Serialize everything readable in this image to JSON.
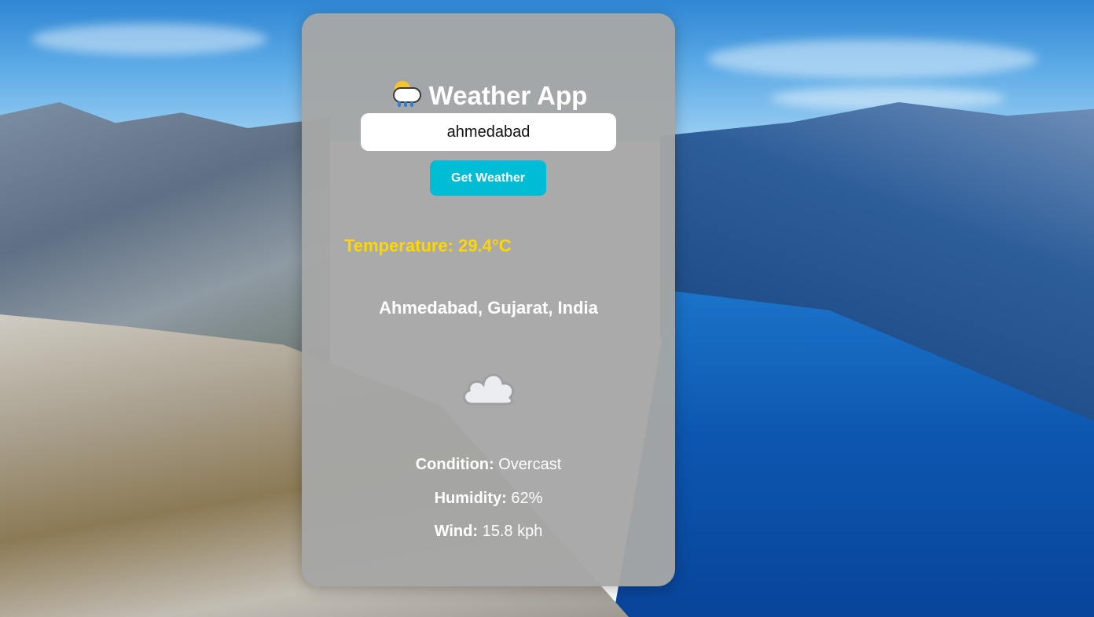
{
  "app": {
    "title": "Weather App",
    "title_icon": "sun-behind-rain-cloud-icon"
  },
  "search": {
    "value": "ahmedabad",
    "button_label": "Get Weather"
  },
  "weather": {
    "temperature_label": "Temperature:",
    "temperature_value": "29.4°C",
    "location": "Ahmedabad, Gujarat, India",
    "condition_icon": "cloud-icon",
    "condition_label": "Condition:",
    "condition_value": "Overcast",
    "humidity_label": "Humidity:",
    "humidity_value": "62%",
    "wind_label": "Wind:",
    "wind_value": "15.8 kph"
  },
  "colors": {
    "accent_button": "#00bcd4",
    "temperature_text": "#ffd700",
    "card_background": "#a5a7a5",
    "text": "#ffffff"
  }
}
